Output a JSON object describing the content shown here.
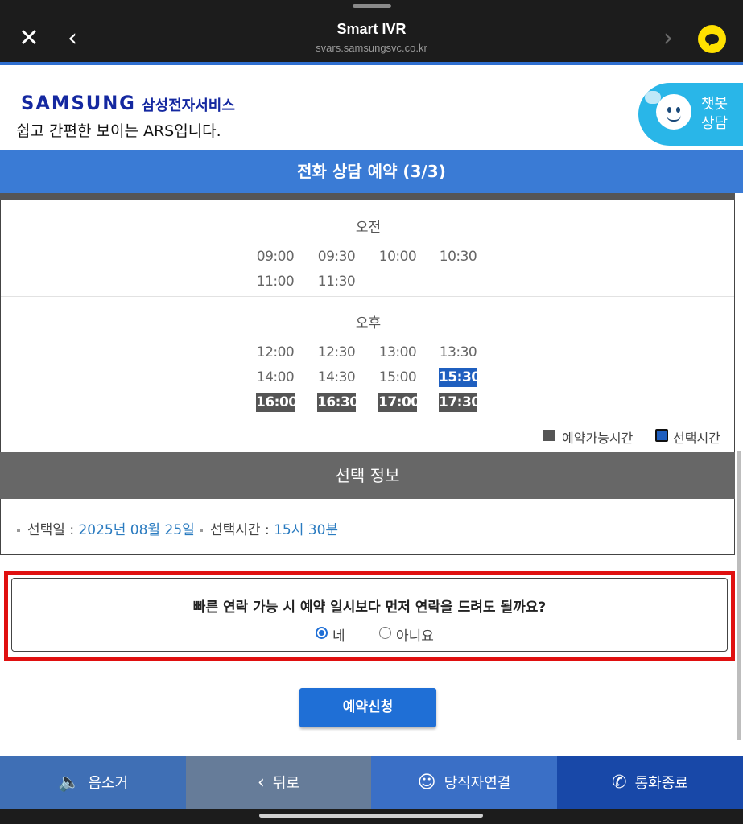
{
  "browser": {
    "title": "Smart IVR",
    "url": "svars.samsungsvc.co.kr",
    "close_icon": "close-icon",
    "back_icon": "chevron-left-icon",
    "forward_icon": "chevron-right-icon",
    "talk_icon": "kakaotalk-icon"
  },
  "header": {
    "logo_text": "SAMSUNG",
    "logo_sub": "삼성전자서비스",
    "tagline": "쉽고 간편한 보이는 ARS입니다.",
    "chatbot_label": "챗봇 상담"
  },
  "section_title": "전화 상담 예약 (3/3)",
  "schedule": {
    "am_label": "오전",
    "pm_label": "오후",
    "am_slots": [
      {
        "time": "09:00",
        "state": "unavailable"
      },
      {
        "time": "09:30",
        "state": "unavailable"
      },
      {
        "time": "10:00",
        "state": "unavailable"
      },
      {
        "time": "10:30",
        "state": "unavailable"
      },
      {
        "time": "11:00",
        "state": "unavailable"
      },
      {
        "time": "11:30",
        "state": "unavailable"
      }
    ],
    "pm_slots": [
      {
        "time": "12:00",
        "state": "unavailable"
      },
      {
        "time": "12:30",
        "state": "unavailable"
      },
      {
        "time": "13:00",
        "state": "unavailable"
      },
      {
        "time": "13:30",
        "state": "unavailable"
      },
      {
        "time": "14:00",
        "state": "unavailable"
      },
      {
        "time": "14:30",
        "state": "unavailable"
      },
      {
        "time": "15:00",
        "state": "unavailable"
      },
      {
        "time": "15:30",
        "state": "selected"
      },
      {
        "time": "16:00",
        "state": "available"
      },
      {
        "time": "16:30",
        "state": "available"
      },
      {
        "time": "17:00",
        "state": "available"
      },
      {
        "time": "17:30",
        "state": "available"
      }
    ],
    "legend_available": "예약가능시간",
    "legend_selected": "선택시간"
  },
  "selection": {
    "header": "선택 정보",
    "date_label": "선택일 : ",
    "date_value": "2025년 08월 25일",
    "time_label": "선택시간 : ",
    "time_value": "15시 30분"
  },
  "question": {
    "text": "빠른 연락 가능 시 예약 일시보다 먼저 연락을 드려도 될까요?",
    "yes_label": "네",
    "no_label": "아니요",
    "selected": "yes"
  },
  "submit_label": "예약신청",
  "bottom_bar": {
    "mute_label": "음소거",
    "back_label": "뒤로",
    "agent_label": "당직자연결",
    "end_label": "통화종료"
  },
  "colors": {
    "primary_blue": "#3a7bd5",
    "selected_blue": "#1f5fbf",
    "available_gray": "#555555",
    "highlight_red": "#e01010",
    "value_blue": "#2a7bc0"
  }
}
